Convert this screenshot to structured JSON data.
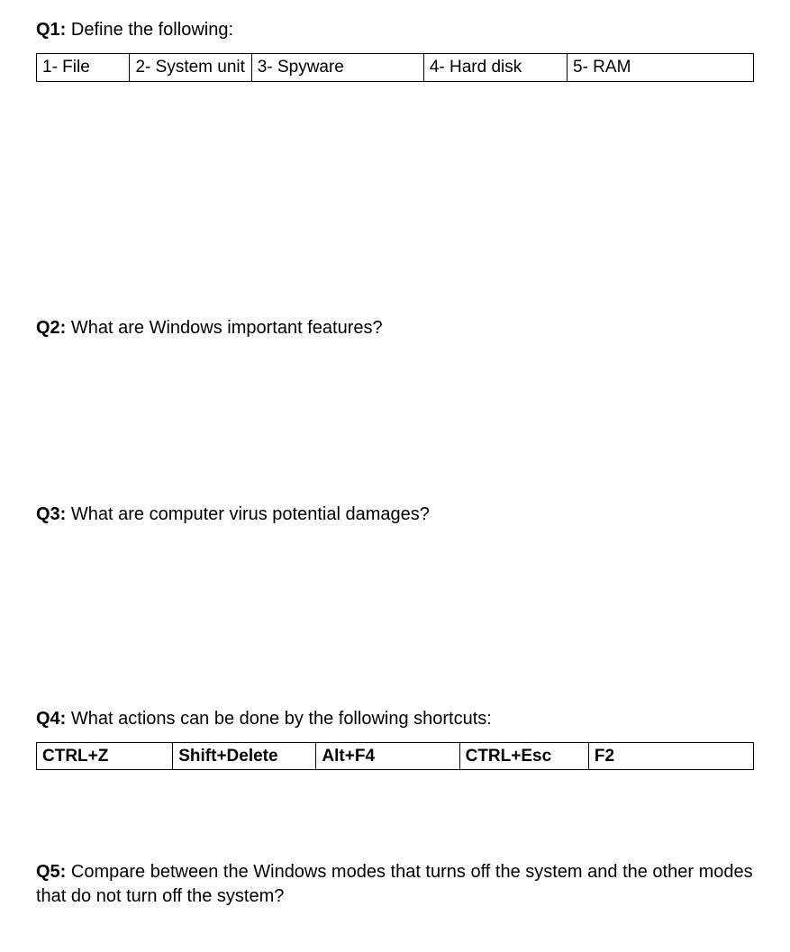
{
  "q1": {
    "label": "Q1:",
    "text": " Define the following:",
    "terms": [
      "1- File",
      "2- System unit",
      "3- Spyware",
      "4- Hard disk",
      "5- RAM"
    ]
  },
  "q2": {
    "label": "Q2:",
    "text": " What are Windows important features?"
  },
  "q3": {
    "label": "Q3:",
    "text": " What are computer virus potential damages?"
  },
  "q4": {
    "label": "Q4:",
    "text": " What actions can be done by the following shortcuts:",
    "shortcuts": [
      "CTRL+Z",
      "Shift+Delete",
      "Alt+F4",
      "CTRL+Esc",
      "F2"
    ]
  },
  "q5": {
    "label": "Q5:",
    "text": " Compare between the Windows modes that turns off the system and the other modes that do not turn off the system?"
  }
}
